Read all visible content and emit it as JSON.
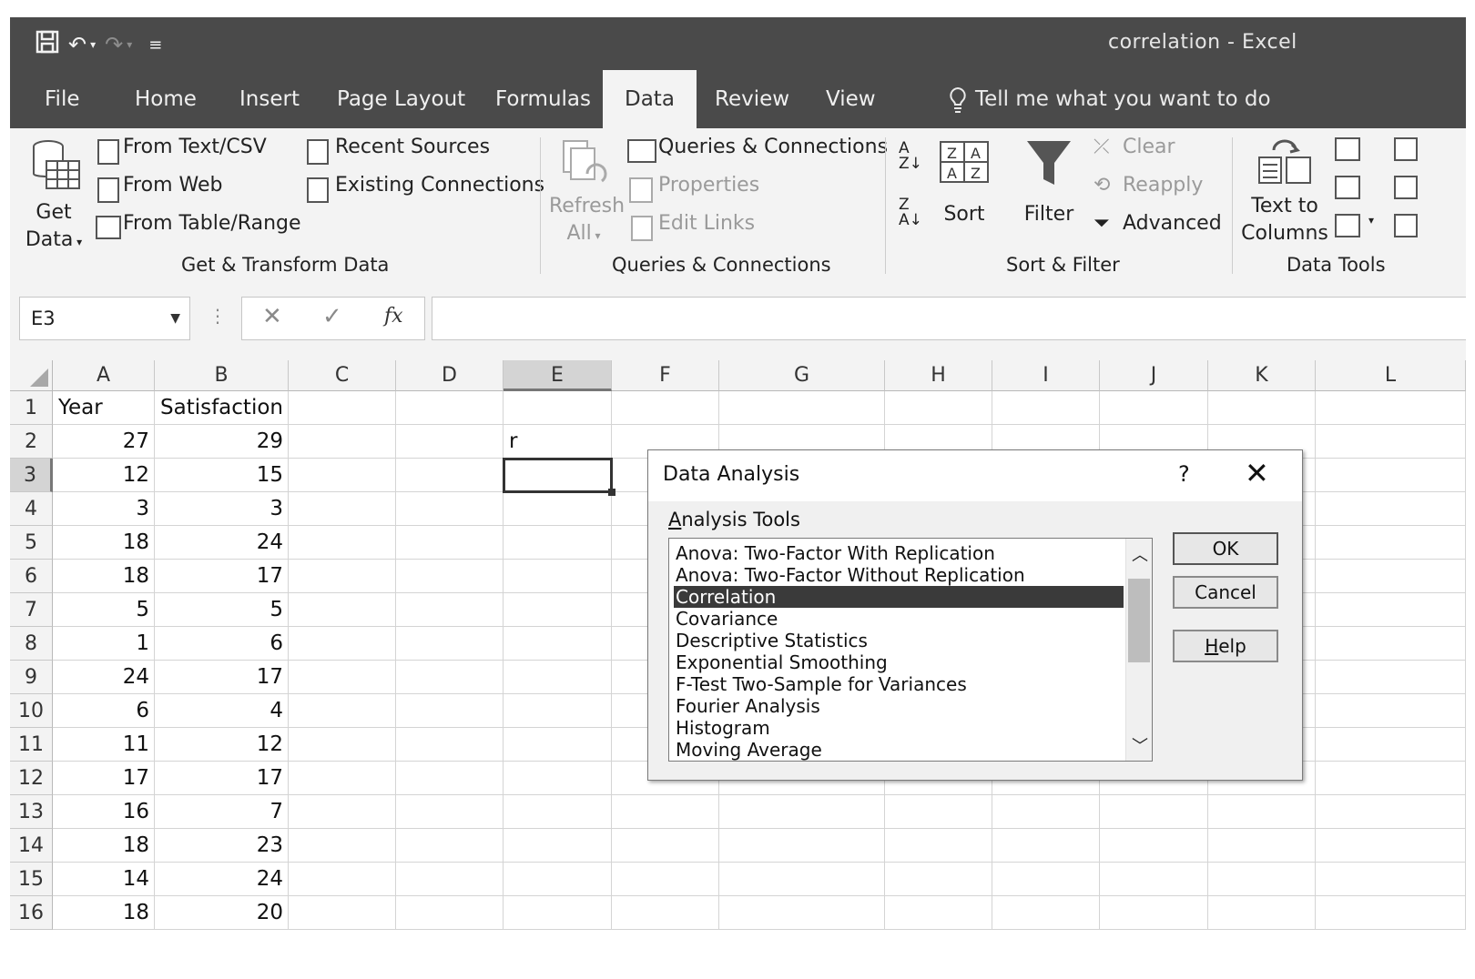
{
  "window": {
    "title": "correlation  -  Excel"
  },
  "qat": {
    "save_icon": "save-icon",
    "undo_icon": "undo-icon",
    "redo_icon": "redo-icon",
    "customize_icon": "customize-qat-icon"
  },
  "tabs": [
    {
      "label": "File"
    },
    {
      "label": "Home"
    },
    {
      "label": "Insert"
    },
    {
      "label": "Page Layout"
    },
    {
      "label": "Formulas"
    },
    {
      "label": "Data"
    },
    {
      "label": "Review"
    },
    {
      "label": "View"
    }
  ],
  "active_tab": "Data",
  "tell_me": "Tell me what you want to do",
  "ribbon": {
    "get_transform": {
      "get_data_line1": "Get",
      "get_data_line2": "Data",
      "from_text": "From Text/CSV",
      "from_web": "From Web",
      "from_table": "From Table/Range",
      "recent_sources": "Recent Sources",
      "existing_connections": "Existing Connections",
      "group_label": "Get & Transform Data"
    },
    "queries": {
      "refresh_line1": "Refresh",
      "refresh_line2": "All",
      "queries_connections": "Queries & Connections",
      "properties": "Properties",
      "edit_links": "Edit Links",
      "group_label": "Queries & Connections"
    },
    "sort_filter": {
      "sort": "Sort",
      "filter": "Filter",
      "clear": "Clear",
      "reapply": "Reapply",
      "advanced": "Advanced",
      "group_label": "Sort & Filter"
    },
    "data_tools": {
      "text_to_line1": "Text to",
      "text_to_line2": "Columns",
      "group_label": "Data Tools"
    }
  },
  "formula_bar": {
    "name_box": "E3",
    "cancel": "✕",
    "enter": "✓",
    "fx": "fx",
    "formula": ""
  },
  "columns": [
    "A",
    "B",
    "C",
    "D",
    "E",
    "F",
    "G",
    "H",
    "I",
    "J",
    "K",
    "L"
  ],
  "rows": [
    "1",
    "2",
    "3",
    "4",
    "5",
    "6",
    "7",
    "8",
    "9",
    "10",
    "11",
    "12",
    "13",
    "14",
    "15",
    "16"
  ],
  "sheet": {
    "header_a": "Year",
    "header_b": "Satisfaction",
    "e2": "r",
    "year": [
      "27",
      "12",
      "3",
      "18",
      "18",
      "5",
      "1",
      "24",
      "6",
      "11",
      "17",
      "16",
      "18",
      "14",
      "18"
    ],
    "satisfaction": [
      "29",
      "15",
      "3",
      "24",
      "17",
      "5",
      "6",
      "17",
      "4",
      "12",
      "17",
      "7",
      "23",
      "24",
      "20"
    ]
  },
  "dialog": {
    "title": "Data Analysis",
    "help_glyph": "?",
    "close_glyph": "✕",
    "list_label_accel": "A",
    "list_label_rest": "nalysis Tools",
    "tools": [
      "Anova: Two-Factor With Replication",
      "Anova: Two-Factor Without Replication",
      "Correlation",
      "Covariance",
      "Descriptive Statistics",
      "Exponential Smoothing",
      "F-Test Two-Sample for Variances",
      "Fourier Analysis",
      "Histogram",
      "Moving Average"
    ],
    "selected_tool": "Correlation",
    "ok": "OK",
    "cancel": "Cancel",
    "help_accel": "H",
    "help_rest": "elp"
  }
}
